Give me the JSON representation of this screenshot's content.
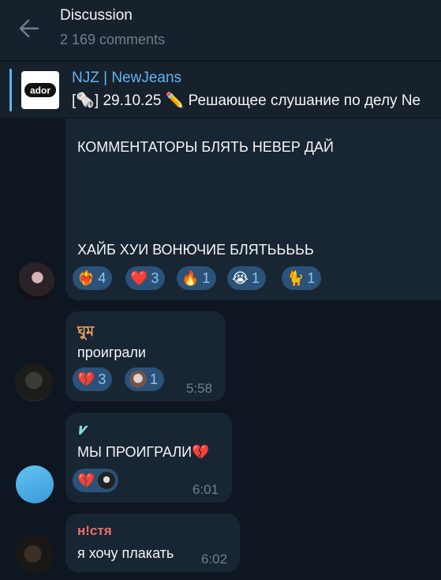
{
  "header": {
    "title": "Discussion",
    "subtitle": "2 169 comments"
  },
  "pinned": {
    "channel": "NJZ | NewJeans",
    "preview": "[🗞️] 29.10.25  ✏️ Решающее слушание по делу Ne",
    "logo_text": "ador"
  },
  "messages": [
    {
      "line1": "КОММЕНТАТОРЫ БЛЯТЬ НЕВЕР ДАЙ",
      "line2": "ХАЙБ ХУИ ВОНЮЧИЕ БЛЯТЬЬЬЬЬ",
      "reactions": [
        {
          "emoji": "❤️‍🔥",
          "count": "4"
        },
        {
          "emoji": "❤️",
          "count": "3"
        },
        {
          "emoji": "🔥",
          "count": "1"
        },
        {
          "emoji": "😭",
          "count": "1"
        },
        {
          "emoji": "🐈",
          "count": "1"
        }
      ]
    },
    {
      "author": "ঘুম",
      "author_color": "#f2a55c",
      "text": "проиграли",
      "time": "5:58",
      "reactions": [
        {
          "emoji": "💔",
          "count": "3"
        },
        {
          "emoji": "",
          "count": "1"
        }
      ]
    },
    {
      "author": "𝝂",
      "author_color": "#7ee0d8",
      "text": "МЫ ПРОИГРАЛИ💔",
      "time": "6:01",
      "reactions": [
        {
          "emoji": "💔",
          "count": ""
        }
      ]
    },
    {
      "author": "н!стя",
      "author_color": "#f06b6b",
      "text": "я хочу плакать",
      "time": "6:02"
    }
  ],
  "colors": {
    "background": "#0e1621",
    "bubble": "#182533",
    "accent": "#5eb5f7",
    "reaction": "#2b5278"
  }
}
